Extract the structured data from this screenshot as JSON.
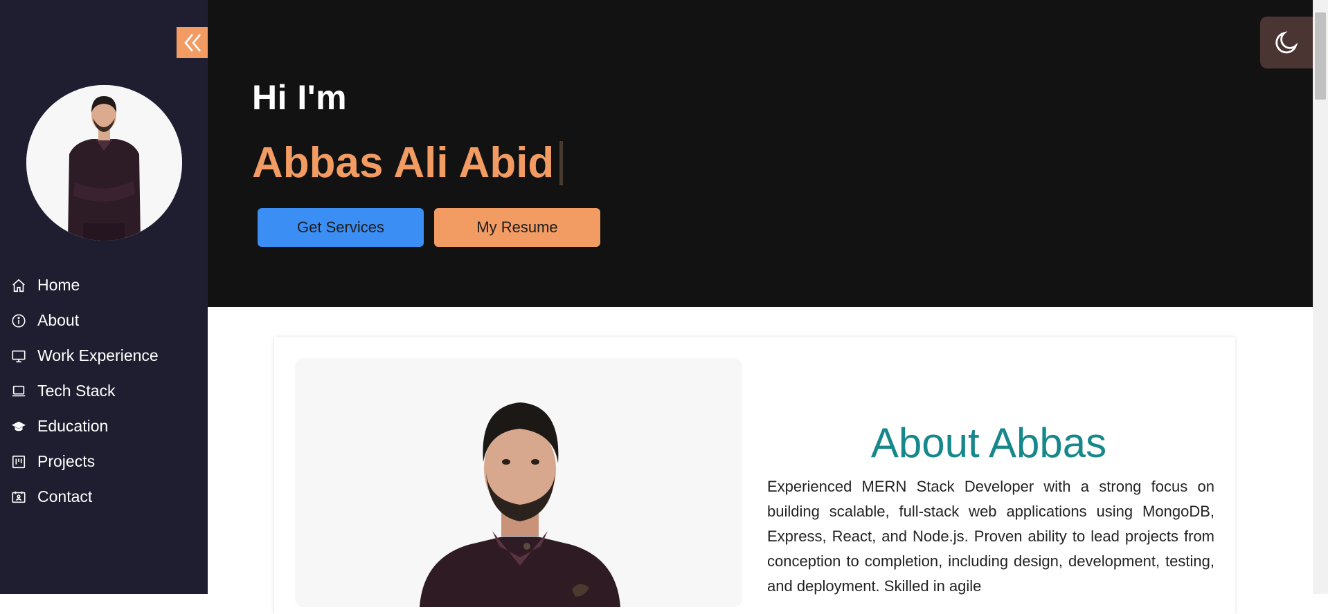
{
  "sidebar": {
    "collapse_icon": "double-chevron-left-icon",
    "nav": [
      {
        "label": "Home",
        "icon": "home-icon"
      },
      {
        "label": "About",
        "icon": "info-icon"
      },
      {
        "label": "Work Experience",
        "icon": "monitor-icon"
      },
      {
        "label": "Tech Stack",
        "icon": "laptop-icon"
      },
      {
        "label": "Education",
        "icon": "graduation-cap-icon"
      },
      {
        "label": "Projects",
        "icon": "kanban-icon"
      },
      {
        "label": "Contact",
        "icon": "contact-card-icon"
      }
    ]
  },
  "hero": {
    "greeting": "Hi I'm",
    "name": "Abbas Ali Abid",
    "services_label": "Get Services",
    "resume_label": "My Resume",
    "theme_icon": "moon-icon"
  },
  "about": {
    "title": "About Abbas",
    "text": "Experienced MERN Stack Developer with a strong focus on building scalable, full-stack web applications using MongoDB, Express, React, and Node.js. Proven ability to lead projects from conception to completion, including design, development, testing, and deployment. Skilled in agile"
  },
  "colors": {
    "sidebar_bg": "#1f1e30",
    "hero_bg": "#121212",
    "accent_orange": "#f29b62",
    "accent_blue": "#3b8ef3",
    "teal_title": "#16878a"
  }
}
